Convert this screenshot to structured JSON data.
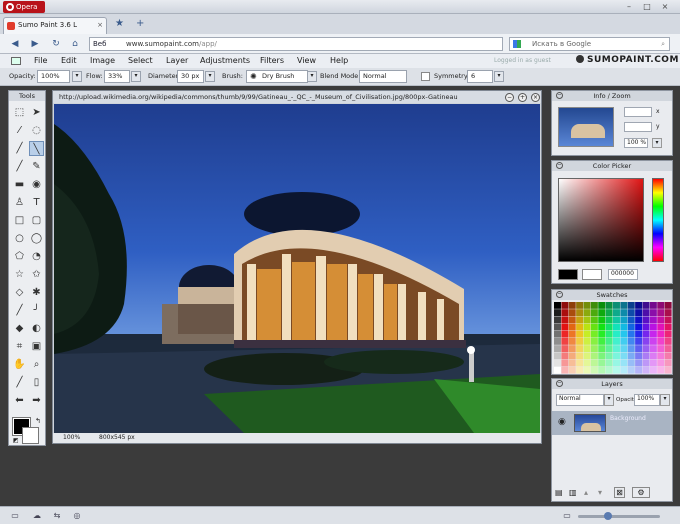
{
  "browser": {
    "menu_label": "Opera",
    "window_controls": [
      "–",
      "□",
      "×"
    ],
    "tab": {
      "title": "Sumo Paint 3.6 L",
      "close": "×"
    },
    "new_tab": "+",
    "address": {
      "prefix": "Веб",
      "domain": "www.sumopaint.com",
      "path": "/app/"
    },
    "search_placeholder": "Искать в Google",
    "nav_icons": [
      "back-icon",
      "forward-icon",
      "reload-icon",
      "home-icon"
    ]
  },
  "app": {
    "menus": [
      "File",
      "Edit",
      "Image",
      "Select",
      "Layer",
      "Adjustments",
      "Filters",
      "View",
      "Help"
    ],
    "logged_in": "Logged in as guest",
    "brand": "SUMOPAINT.COM",
    "options": {
      "opacity_label": "Opacity:",
      "opacity": "100%",
      "flow_label": "Flow:",
      "flow": "33%",
      "diameter_label": "Diameter:",
      "diameter": "30 px",
      "brush_label": "Brush:",
      "brush": "Dry Brush",
      "blend_label": "Blend Mode:",
      "blend": "Normal",
      "symmetry_label": "Symmetry",
      "symmetry": "6"
    }
  },
  "tools": {
    "title": "Tools",
    "icons": [
      "marquee-icon",
      "move-icon",
      "magic-wand-icon",
      "lasso-icon",
      "eyedropper-icon",
      "brush-icon",
      "pencil-icon",
      "airbrush-icon",
      "gradient-icon",
      "bucket-icon",
      "stamp-icon",
      "text-icon",
      "rectangle-icon",
      "rounded-rect-icon",
      "ellipse-icon",
      "circle-icon",
      "polygon-icon",
      "blob-icon",
      "star-icon",
      "star-outline-icon",
      "heart-icon",
      "flower-icon",
      "line-icon",
      "curve-icon",
      "smudge-icon",
      "dodge-icon",
      "crop-icon",
      "transform-icon",
      "hand-icon",
      "zoom-icon",
      "picker-icon",
      "eraser-icon",
      "arrow-left-icon",
      "arrow-right-icon"
    ],
    "glyphs": [
      "⬚",
      "➤",
      "⁄",
      "◌",
      "╱",
      "╲",
      "╱",
      "✎",
      "▬",
      "◉",
      "♙",
      "T",
      "□",
      "▢",
      "○",
      "◯",
      "⬠",
      "◔",
      "☆",
      "✩",
      "◇",
      "✱",
      "╱",
      "╯",
      "◆",
      "◐",
      "⌗",
      "▣",
      "✋",
      "⌕",
      "╱",
      "▯",
      "⬅",
      "➡"
    ]
  },
  "canvas": {
    "title": "http://upload.wikimedia.org/wikipedia/commons/thumb/9/99/Gatineau_-_QC_-_Museum_of_Civilisation.jpg/800px-Gatineau",
    "zoom": "100%",
    "size": "800x545 px"
  },
  "panels": {
    "info": {
      "title": "Info / Zoom",
      "x_label": "x",
      "y_label": "y",
      "zoom": "100 %"
    },
    "color": {
      "title": "Color Picker",
      "hex": "000000"
    },
    "swatches": {
      "title": "Swatches"
    },
    "layers": {
      "title": "Layers",
      "blend": "Normal",
      "opacity_label": "Opacity:",
      "opacity": "100%",
      "layer_name": "Background"
    }
  },
  "colors": {
    "accent": "#3a5b8c",
    "opera_red": "#b8131a",
    "workspace": "#3b3b3b"
  }
}
